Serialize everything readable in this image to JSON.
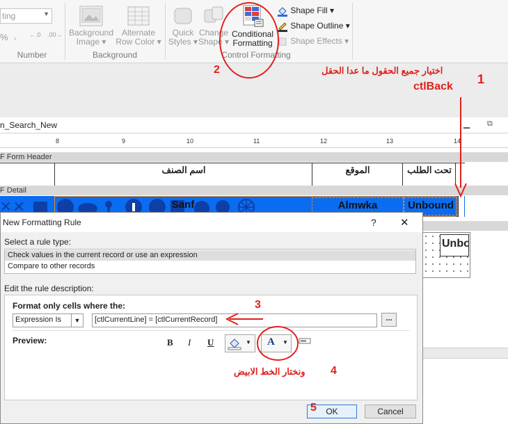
{
  "ribbon": {
    "format_box": "ting",
    "number_symbols": [
      "%",
      ",",
      "←.0",
      ".00→"
    ],
    "groups": {
      "number": "Number",
      "background": "Background",
      "control_formatting": "Control Formatting"
    },
    "background_image": [
      "Background",
      "Image ▾"
    ],
    "alternate_row_color": [
      "Alternate",
      "Row Color ▾"
    ],
    "quick_styles": [
      "Quick",
      "Styles ▾"
    ],
    "change_shape": [
      "Change",
      "Shape ▾"
    ],
    "conditional_formatting": [
      "Conditional",
      "Formatting"
    ],
    "shape_fill": "Shape Fill ▾",
    "shape_outline": "Shape Outline ▾",
    "shape_effects": "Shape Effects ▾"
  },
  "annotations": {
    "n1": "1",
    "n1_text_ar": "اختيار جميع الحقول ما عدا الحقل",
    "n1_text_field": "ctlBack",
    "n2": "2",
    "n3": "3",
    "n4": "4",
    "n4_text_ar": "ونختار الخط الابيض",
    "n5": "5"
  },
  "form": {
    "tab_name": "n_Search_New",
    "ruler_ticks": [
      "8",
      "9",
      "10",
      "11",
      "12",
      "13",
      "14"
    ],
    "form_header": "F Form Header",
    "detail": "F Detail",
    "headers": [
      "اسم الصنف",
      "الموقع",
      "تحت الطلب"
    ],
    "fields": [
      "Sanf",
      "Almwka",
      "Unbound"
    ],
    "right_box_text": "Unbo"
  },
  "dialog": {
    "title": "New Formatting Rule",
    "help": "?",
    "close": "✕",
    "select_rule_label": "Select a rule type:",
    "rule_types": [
      "Check values in the current record or use an expression",
      "Compare to other records"
    ],
    "edit_desc_label": "Edit the rule description:",
    "format_only_label": "Format only cells where the:",
    "condition_select": "Expression Is",
    "expression": "[ctlCurrentLine] = [ctlCurrentRecord]",
    "ellipsis": "...",
    "preview_label": "Preview:",
    "bold": "B",
    "italic": "I",
    "underline": "U",
    "font_color_letter": "A",
    "ok": "OK",
    "cancel": "Cancel"
  },
  "colors": {
    "annotation_red": "#e0201c",
    "detail_blue": "#0a6cf0",
    "shape_outline_orange": "#e88a2a"
  }
}
